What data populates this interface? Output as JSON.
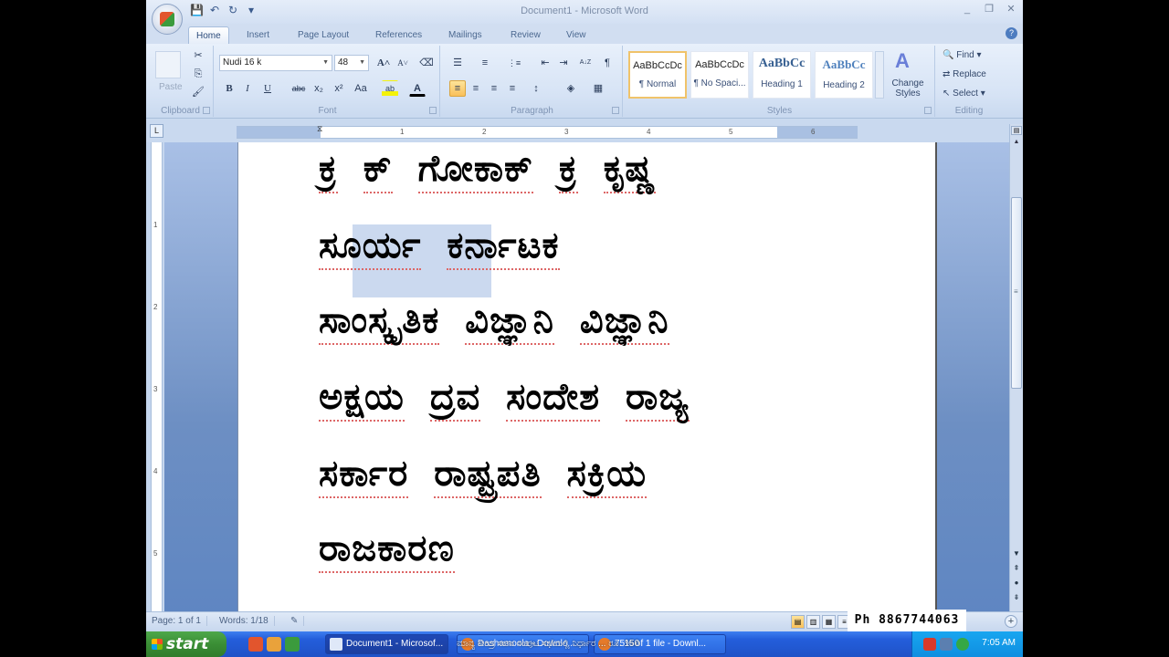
{
  "window": {
    "title": "Document1 - Microsoft Word",
    "controls": {
      "minimize": "_",
      "restore": "❐",
      "close": "✕"
    }
  },
  "quick_access": {
    "save_icon": "💾",
    "undo_icon": "↶",
    "redo_icon": "↻",
    "customize_icon": "▾"
  },
  "tabs": [
    "Home",
    "Insert",
    "Page Layout",
    "References",
    "Mailings",
    "Review",
    "View"
  ],
  "active_tab": "Home",
  "ribbon": {
    "clipboard": {
      "label": "Clipboard",
      "paste": "Paste",
      "cut_icon": "✂",
      "copy_icon": "⎘",
      "format_painter_icon": "🖌"
    },
    "font": {
      "label": "Font",
      "font_name": "Nudi 16 k",
      "font_size": "48",
      "grow_font": "A˄",
      "shrink_font": "A˅",
      "clear_format": "⌫",
      "bold": "B",
      "italic": "I",
      "underline": "U",
      "strikethrough": "abc",
      "subscript": "x₂",
      "superscript": "x²",
      "change_case": "Aa",
      "highlight": "ab",
      "font_color": "A"
    },
    "paragraph": {
      "label": "Paragraph",
      "bullets": "☰",
      "numbering": "≡",
      "multilevel": "⋮≡",
      "decrease_indent": "⇤",
      "increase_indent": "⇥",
      "sort": "A↓Z",
      "show_marks": "¶",
      "align_left": "≡",
      "center": "≡",
      "align_right": "≡",
      "justify": "≡",
      "line_spacing": "↕",
      "shading": "◈",
      "borders": "▦"
    },
    "styles": {
      "label": "Styles",
      "items": [
        {
          "sample": "AaBbCcDc",
          "name": "¶ Normal"
        },
        {
          "sample": "AaBbCcDc",
          "name": "¶ No Spaci..."
        },
        {
          "sample": "AaBbCc",
          "name": "Heading 1"
        },
        {
          "sample": "AaBbCc",
          "name": "Heading 2"
        }
      ],
      "selected_index": 0,
      "change_styles": "Change Styles"
    },
    "editing": {
      "label": "Editing",
      "find": "Find",
      "replace": "Replace",
      "select": "Select"
    }
  },
  "ruler": {
    "horizontal_ticks": [
      "1",
      "1",
      "2",
      "3",
      "4",
      "5",
      "6"
    ],
    "vertical_ticks": [
      "1",
      "2",
      "3",
      "4",
      "5"
    ]
  },
  "document": {
    "lines": [
      [
        "ಕ್ರ",
        "ಕ್",
        "ಗೋಕಾಕ್",
        "ಕ್ರ",
        "ಕೃಷ್ಣ"
      ],
      [
        "ಸೂರ್ಯ",
        "ಕರ್ನಾಟಕ"
      ],
      [
        "ಸಾಂಸ್ಕೃತಿಕ",
        "ವಿಜ್ಞಾನಿ",
        "ವಿಜ್ಞಾನಿ"
      ],
      [
        "ಅಕ್ಷಯ",
        "ದ್ರವ",
        "ಸಂದೇಶ",
        "ರಾಜ್ಯ"
      ],
      [
        "ಸರ್ಕಾರ",
        "ರಾಷ್ಟ್ರಪತಿ",
        "ಸಕ್ರಿಯ"
      ],
      [
        "ರಾಜಕಾರಣ"
      ]
    ],
    "selected_word": "ಸೂರ್ಯ"
  },
  "statusbar": {
    "page": "Page: 1 of 1",
    "words": "Words: 1/18",
    "proofing_icon": "✎",
    "view_buttons": [
      "Print Layout",
      "Full Screen Reading",
      "Web Layout",
      "Outline",
      "Draft"
    ],
    "zoom_in": "+"
  },
  "overlay": {
    "phone": "Ph 8867744063"
  },
  "taskbar": {
    "start": "start",
    "tasks": [
      {
        "label": "Document1 - Microsof...",
        "active": true
      },
      {
        "label": "Dashamoola - Downlo...",
        "active": false
      },
      {
        "label": "75% of 1 file - Downl...",
        "active": false
      }
    ],
    "ticker": "ಮಾನ್ಯ ಕೇಂದ್ರ ಸಚಿವ ಸಂಪುಟ ಸಭೆಯಲ್ಲಿ ನಿರ್ಧಾರ ... ರೂ. 150",
    "clock": "7:05 AM"
  }
}
